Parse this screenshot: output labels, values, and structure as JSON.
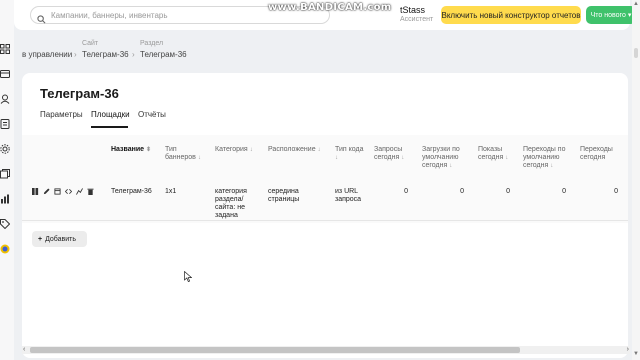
{
  "header": {
    "search_placeholder": "Кампании, баннеры, инвентарь",
    "watermark": "www.BANDICAM.com",
    "user_name": "tStass",
    "user_role": "Ассистент",
    "constructor_button": "Включить новый конструктор отчетов",
    "whats_new_button": "Что нового",
    "accent_yellow": "#ffdb4d",
    "accent_green": "#3fc26b"
  },
  "breadcrumb": {
    "items": [
      {
        "label": "",
        "value": "в управлении"
      },
      {
        "label": "Сайт",
        "value": "Телеграм-36"
      },
      {
        "label": "Раздел",
        "value": "Телеграм-36"
      }
    ]
  },
  "page": {
    "title": "Телеграм-36",
    "tabs": [
      "Параметры",
      "Площадки",
      "Отчёты"
    ],
    "active_tab": "Площадки"
  },
  "table": {
    "columns": [
      "Название",
      "Тип баннеров",
      "Категория",
      "Расположение",
      "Тип кода",
      "Запросы сегодня",
      "Загрузки по умолчанию сегодня",
      "Показы сегодня",
      "Переходы по умолчанию сегодня",
      "Переходы сегодня"
    ],
    "rows": [
      {
        "name": "Телеграм-36",
        "banner_type": "1x1",
        "category": "категория раздела/сайта: не задана",
        "placement": "середина страницы",
        "code_type": "из URL запроса",
        "requests_today": "0",
        "default_loads_today": "0",
        "impressions_today": "0",
        "default_clicks_today": "0",
        "clicks_today": "0"
      }
    ],
    "row_actions": [
      "bars-icon",
      "pencil-icon",
      "copy-icon",
      "code-icon",
      "chart-icon",
      "trash-icon"
    ]
  },
  "add_button": "Добавить",
  "sidebar_icons": [
    "grid-icon",
    "campaign-icon",
    "user-icon",
    "report-icon",
    "settings-icon",
    "stack-icon",
    "chart-icon",
    "tag-icon",
    "coin-icon"
  ]
}
